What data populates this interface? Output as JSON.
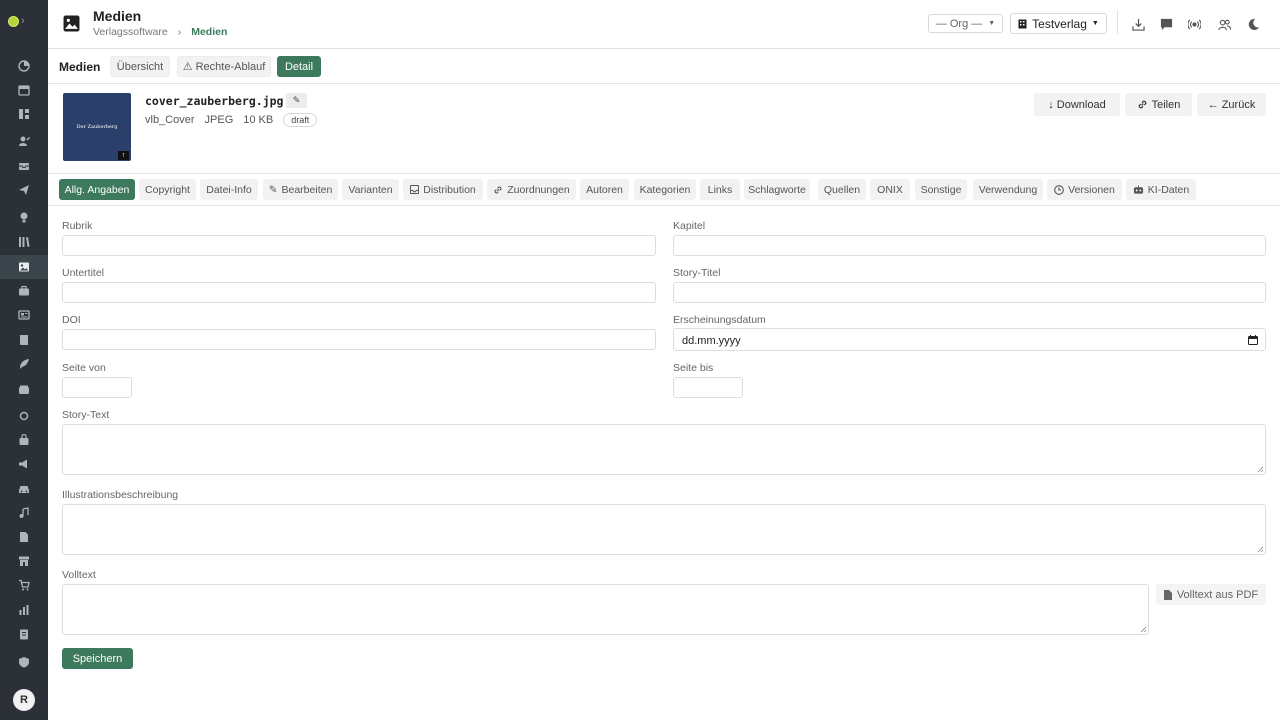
{
  "header": {
    "title": "Medien",
    "breadcrumb": [
      "Verlagssoftware",
      "Medien"
    ],
    "breadcrumb_sep": "›",
    "org_select": "— Org —",
    "publisher_select": "Testverlag"
  },
  "sidebar": {
    "avatar": "R",
    "icons": [
      "dashboard-icon",
      "calendar-icon",
      "layout-icon",
      "user-edit-icon",
      "inbox-icon",
      "send-icon",
      "lightbulb-icon",
      "library-icon",
      "image-icon",
      "briefcase-icon",
      "news-icon",
      "book-icon",
      "feather-icon",
      "wallet-icon",
      "circle-icon",
      "bag-icon",
      "megaphone-icon",
      "car-icon",
      "music-icon",
      "file-icon",
      "store-icon",
      "cart-icon",
      "chart-icon",
      "clipboard-icon",
      "shield-icon"
    ],
    "active_index": 8
  },
  "topnav": {
    "title": "Medien",
    "tabs": [
      "Übersicht",
      "⚠ Rechte-Ablauf",
      "Detail"
    ],
    "active": "Detail"
  },
  "media": {
    "cover_title": "Der Zauberberg",
    "filename": "cover_zauberberg.jpg",
    "type": "vlb_Cover",
    "format": "JPEG",
    "size": "10 KB",
    "status": "draft",
    "edit_icon": "✎",
    "actions": {
      "download": "↓ Download",
      "share": "Teilen",
      "back": "← Zurück"
    }
  },
  "tabs": [
    {
      "label": "Allg. Angaben"
    },
    {
      "label": "Copyright"
    },
    {
      "label": "Datei-Info"
    },
    {
      "label": "Bearbeiten",
      "icon": "✎"
    },
    {
      "label": "Varianten"
    },
    {
      "label": "Distribution"
    },
    {
      "label": "Zuordnungen"
    },
    {
      "label": "Autoren"
    },
    {
      "label": "Kategorien"
    },
    {
      "label": "Links"
    },
    {
      "label": "Schlagworte"
    },
    {
      "label": "Quellen"
    },
    {
      "label": "ONIX"
    },
    {
      "label": "Sonstige"
    },
    {
      "label": "Verwendung"
    },
    {
      "label": "Versionen"
    },
    {
      "label": "KI-Daten"
    }
  ],
  "form": {
    "rubrik": {
      "label": "Rubrik",
      "value": ""
    },
    "kapitel": {
      "label": "Kapitel",
      "value": ""
    },
    "untertitel": {
      "label": "Untertitel",
      "value": ""
    },
    "story_titel": {
      "label": "Story-Titel",
      "value": ""
    },
    "doi": {
      "label": "DOI",
      "value": ""
    },
    "erscheinungsdatum": {
      "label": "Erscheinungsdatum",
      "placeholder": "dd.mm.yyyy"
    },
    "seite_von": {
      "label": "Seite von",
      "value": ""
    },
    "seite_bis": {
      "label": "Seite bis",
      "value": ""
    },
    "story_text": {
      "label": "Story-Text",
      "value": ""
    },
    "illustrationsbeschreibung": {
      "label": "Illustrationsbeschreibung",
      "value": ""
    },
    "volltext": {
      "label": "Volltext",
      "value": ""
    },
    "pdf_button": "Volltext aus PDF",
    "save_button": "Speichern"
  },
  "colors": {
    "accent": "#3d7a5d",
    "sidebar": "#2b3136"
  }
}
